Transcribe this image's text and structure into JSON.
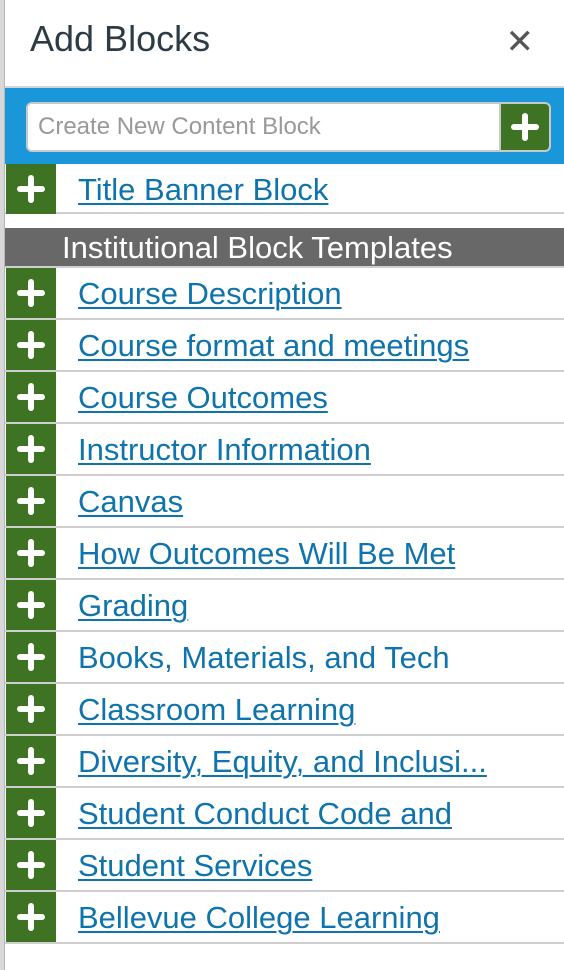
{
  "dialog": {
    "title": "Add Blocks",
    "close_icon": "close-icon"
  },
  "create": {
    "placeholder": "Create New Content Block",
    "value": "",
    "add_icon": "plus-icon"
  },
  "top_blocks": [
    {
      "label": " Title Banner Block",
      "underlined": true
    }
  ],
  "section": {
    "title": "Institutional Block Templates"
  },
  "blocks": [
    {
      "label": " Course Description",
      "underlined": true
    },
    {
      "label": " Course format and meetings",
      "underlined": true
    },
    {
      "label": " Course Outcomes",
      "underlined": true
    },
    {
      "label": " Instructor Information",
      "underlined": true
    },
    {
      "label": " Canvas",
      "underlined": true
    },
    {
      "label": " How Outcomes Will Be Met",
      "underlined": true
    },
    {
      "label": " Grading",
      "underlined": true
    },
    {
      "label": " Books, Materials, and Tech",
      "underlined": false
    },
    {
      "label": " Classroom Learning",
      "underlined": true
    },
    {
      "label": " Diversity, Equity, and Inclusi...",
      "underlined": true
    },
    {
      "label": " Student Conduct Code and",
      "underlined": true
    },
    {
      "label": " Student Services",
      "underlined": true
    },
    {
      "label": " Bellevue College Learning",
      "underlined": true
    }
  ],
  "colors": {
    "accent_blue": "#1a97d8",
    "add_green": "#3d7323",
    "link_blue": "#0f74ad",
    "section_gray": "#686868"
  }
}
